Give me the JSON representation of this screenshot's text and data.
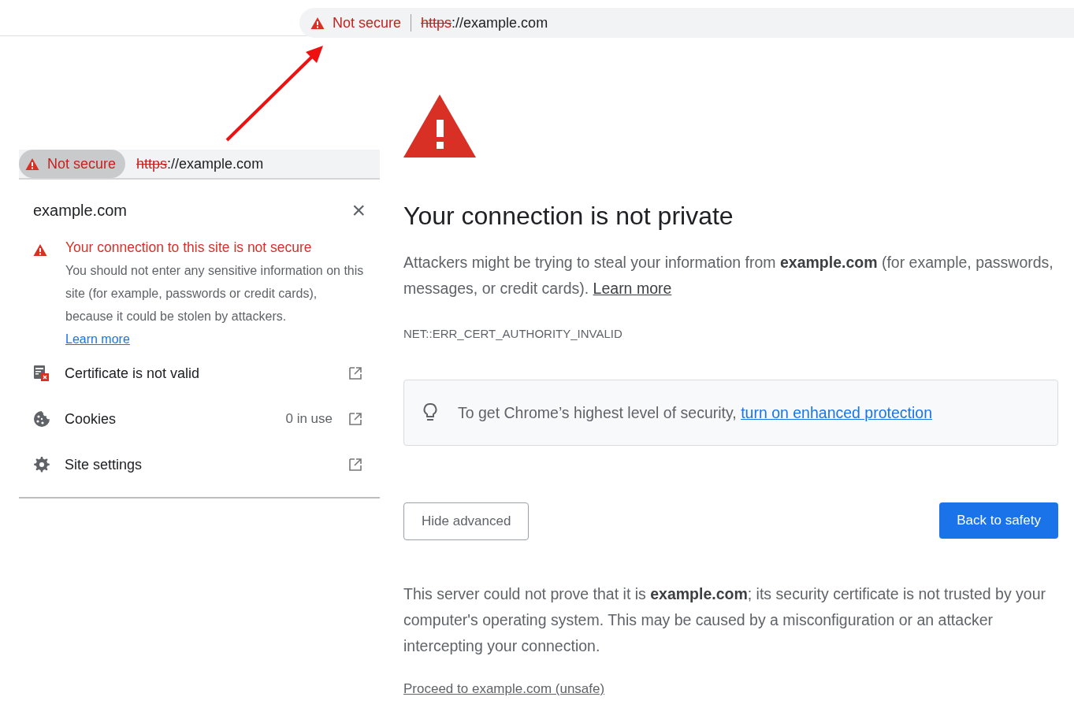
{
  "top_address_bar": {
    "security_label": "Not secure",
    "chip_pressed": false,
    "scheme": "https",
    "rest": "://example.com"
  },
  "site_info_popup": {
    "address_bar": {
      "security_label": "Not secure",
      "chip_pressed": true,
      "scheme": "https",
      "rest": "://example.com"
    },
    "title": "example.com",
    "close": "×",
    "warning": {
      "heading": "Your connection to this site is not secure",
      "body": "You should not enter any sensitive information on this site (for example, passwords or credit cards), because it could be stolen by attackers.",
      "link": "Learn more"
    },
    "items": [
      {
        "kind": "certificate",
        "label": "Certificate is not valid"
      },
      {
        "kind": "cookies",
        "label": "Cookies",
        "detail": "0 in use"
      },
      {
        "kind": "settings",
        "label": "Site settings"
      }
    ]
  },
  "error_page": {
    "title": "Your connection is not private",
    "intro": {
      "text": "Attackers might be trying to steal your information from **example.com** (for example, passwords, messages, or credit cards).",
      "link": "Learn more"
    },
    "error_code": "NET::ERR_CERT_AUTHORITY_INVALID",
    "tip": {
      "text": "To get Chrome’s highest level of security,",
      "link": "turn on enhanced protection"
    },
    "buttons": [
      {
        "kind": "secondary",
        "label": "Hide advanced"
      },
      {
        "kind": "primary",
        "label": "Back to safety"
      }
    ],
    "details": "This server could not prove that it is **example.com**; its security certificate is not trusted by your computer's operating system. This may be caused by a misconfiguration or an attacker intercepting your connection.",
    "proceed_link": "Proceed to example.com (unsafe)"
  }
}
